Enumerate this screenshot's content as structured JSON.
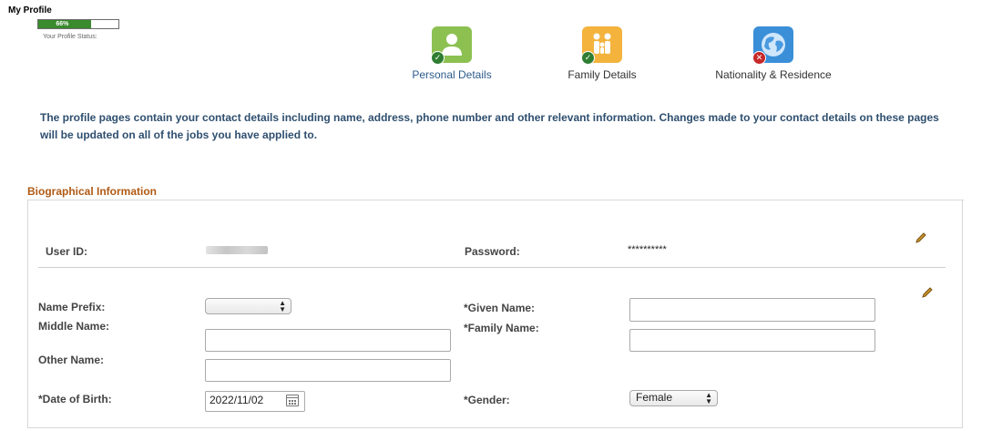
{
  "profile": {
    "title": "My Profile",
    "progress_text": "66%",
    "progress_value": 0.66,
    "status_caption": "Your Profile Status:"
  },
  "steps": [
    {
      "label": "Personal Details",
      "icon": "person-icon",
      "status": "complete",
      "color": "#8cc152",
      "label_color": "#2d5b8a"
    },
    {
      "label": "Family Details",
      "icon": "family-icon",
      "status": "complete",
      "color": "#f3b33d",
      "label_color": "#333333"
    },
    {
      "label": "Nationality & Residence",
      "icon": "globe-icon",
      "status": "incomplete",
      "color": "#3a8fd8",
      "label_color": "#333333"
    }
  ],
  "intro_text": "The profile pages contain your contact details including name, address, phone number and other relevant information. Changes made to your contact details on these pages will be updated on all of the jobs you have applied to.",
  "section": {
    "title": "Biographical Information",
    "user_id_label": "User ID:",
    "password_label": "Password:",
    "password_value": "**********",
    "name_prefix_label": "Name Prefix:",
    "name_prefix_value": "",
    "middle_name_label": "Middle Name:",
    "middle_name_value": "",
    "other_name_label": "Other Name:",
    "other_name_value": "",
    "dob_label": "*Date of Birth:",
    "dob_value": "2022/11/02",
    "given_name_label": "*Given Name:",
    "given_name_value": "",
    "family_name_label": "*Family Name:",
    "family_name_value": "",
    "gender_label": "*Gender:",
    "gender_value": "Female"
  },
  "colors": {
    "accent_brown": "#b05a14",
    "intro_blue": "#2f4f6f",
    "progress_green": "#3a8a2e"
  }
}
